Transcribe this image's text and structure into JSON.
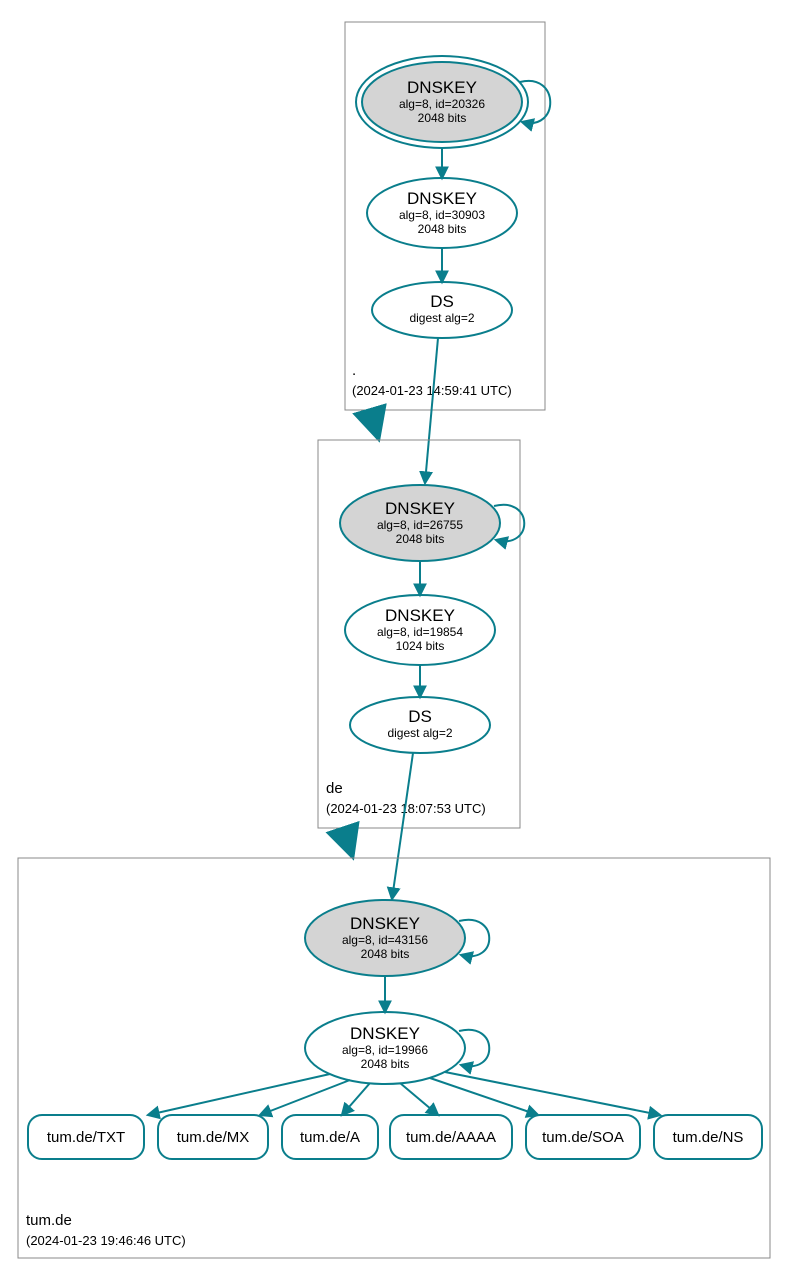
{
  "colors": {
    "stroke": "#0a7e8c",
    "ksk_fill": "#d4d4d4",
    "zone_border": "#888888"
  },
  "zones": {
    "root": {
      "label": ".",
      "timestamp": "(2024-01-23 14:59:41 UTC)",
      "ksk": {
        "title": "DNSKEY",
        "line1": "alg=8, id=20326",
        "line2": "2048 bits"
      },
      "zsk": {
        "title": "DNSKEY",
        "line1": "alg=8, id=30903",
        "line2": "2048 bits"
      },
      "ds": {
        "title": "DS",
        "line1": "digest alg=2"
      }
    },
    "de": {
      "label": "de",
      "timestamp": "(2024-01-23 18:07:53 UTC)",
      "ksk": {
        "title": "DNSKEY",
        "line1": "alg=8, id=26755",
        "line2": "2048 bits"
      },
      "zsk": {
        "title": "DNSKEY",
        "line1": "alg=8, id=19854",
        "line2": "1024 bits"
      },
      "ds": {
        "title": "DS",
        "line1": "digest alg=2"
      }
    },
    "tumde": {
      "label": "tum.de",
      "timestamp": "(2024-01-23 19:46:46 UTC)",
      "ksk": {
        "title": "DNSKEY",
        "line1": "alg=8, id=43156",
        "line2": "2048 bits"
      },
      "zsk": {
        "title": "DNSKEY",
        "line1": "alg=8, id=19966",
        "line2": "2048 bits"
      }
    }
  },
  "rrsets": {
    "txt": "tum.de/TXT",
    "mx": "tum.de/MX",
    "a": "tum.de/A",
    "aaaa": "tum.de/AAAA",
    "soa": "tum.de/SOA",
    "ns": "tum.de/NS"
  }
}
